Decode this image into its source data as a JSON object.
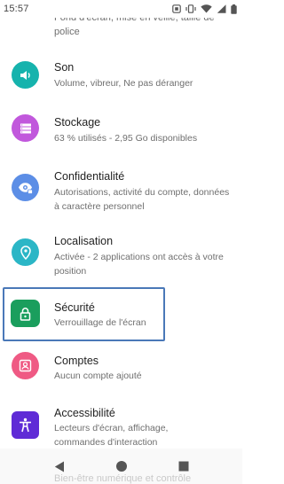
{
  "status_bar": {
    "time": "15:57",
    "icons": [
      "screenshot-icon",
      "vibrate-icon",
      "wifi-icon",
      "signal-icon",
      "battery-icon"
    ]
  },
  "settings": {
    "top_partial": "Fond d'écran, mise en veille, taille de police",
    "items": [
      {
        "id": "sound",
        "title": "Son",
        "subtitle": "Volume, vibreur, Ne pas déranger",
        "icon": "volume-icon",
        "color": "#16b3ad"
      },
      {
        "id": "storage",
        "title": "Stockage",
        "subtitle": "63 % utilisés - 2,95 Go disponibles",
        "icon": "storage-icon",
        "color": "#c158dc"
      },
      {
        "id": "privacy",
        "title": "Confidentialité",
        "subtitle": "Autorisations, activité du compte, données à caractère personnel",
        "icon": "privacy-eye-icon",
        "color": "#5c8ee6"
      },
      {
        "id": "location",
        "title": "Localisation",
        "subtitle": "Activée - 2 applications ont accès à votre position",
        "icon": "location-pin-icon",
        "color": "#2bb6c6"
      },
      {
        "id": "security",
        "title": "Sécurité",
        "subtitle": "Verrouillage de l'écran",
        "icon": "lock-icon",
        "color": "#1a9e5d"
      },
      {
        "id": "accounts",
        "title": "Comptes",
        "subtitle": "Aucun compte ajouté",
        "icon": "account-icon",
        "color": "#ef5a84"
      },
      {
        "id": "accessibility",
        "title": "Accessibilité",
        "subtitle": "Lecteurs d'écran, affichage, commandes d'interaction",
        "icon": "accessibility-icon",
        "color": "#5f2bd6"
      }
    ],
    "bottom_partial": "Bien-être numérique et contrôle"
  },
  "nav_bar": {
    "buttons": [
      "back-icon",
      "home-icon",
      "recents-icon"
    ]
  }
}
